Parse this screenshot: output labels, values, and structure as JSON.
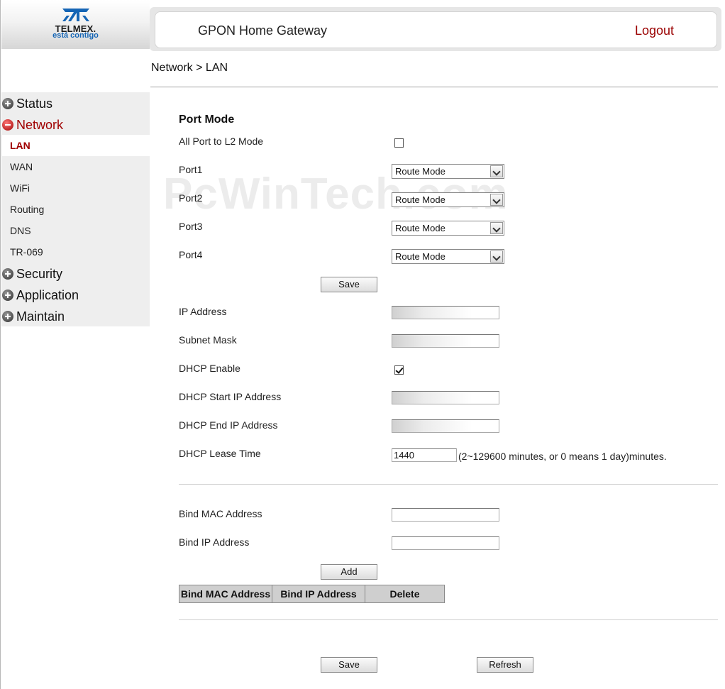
{
  "brand": {
    "name": "TELMEX.",
    "tagline": "está contigo"
  },
  "header": {
    "title": "GPON Home Gateway",
    "logout": "Logout"
  },
  "breadcrumb": "Network > LAN",
  "menu": {
    "status": "Status",
    "network": "Network",
    "network_items": [
      "LAN",
      "WAN",
      "WiFi",
      "Routing",
      "DNS",
      "TR-069"
    ],
    "security": "Security",
    "application": "Application",
    "maintain": "Maintain"
  },
  "port_mode": {
    "title": "Port Mode",
    "all_port_label": "All Port to L2 Mode",
    "all_port_checked": false,
    "ports": [
      {
        "label": "Port1",
        "value": "Route Mode"
      },
      {
        "label": "Port2",
        "value": "Route Mode"
      },
      {
        "label": "Port3",
        "value": "Route Mode"
      },
      {
        "label": "Port4",
        "value": "Route Mode"
      }
    ],
    "save_label": "Save"
  },
  "lan": {
    "ip_address_label": "IP Address",
    "subnet_mask_label": "Subnet Mask",
    "dhcp_enable_label": "DHCP Enable",
    "dhcp_enabled": true,
    "dhcp_start_label": "DHCP Start IP Address",
    "dhcp_end_label": "DHCP End IP Address",
    "dhcp_lease_label": "DHCP Lease Time",
    "dhcp_lease_value": "1440",
    "dhcp_lease_hint": "(2~129600 minutes, or 0 means 1 day)minutes."
  },
  "bind": {
    "mac_label": "Bind MAC Address",
    "ip_label": "Bind IP Address",
    "add_label": "Add",
    "table_headers": [
      "Bind MAC Address",
      "Bind IP Address",
      "Delete"
    ]
  },
  "footer": {
    "save_label": "Save",
    "refresh_label": "Refresh"
  },
  "watermark": "PcWinTech.com",
  "colors": {
    "accent_red": "#a00000",
    "brand_blue": "#1565b5",
    "menu_bg": "#eeeeee"
  }
}
